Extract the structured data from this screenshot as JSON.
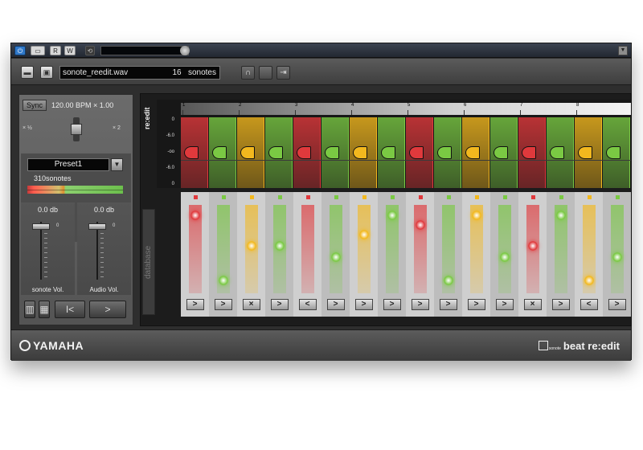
{
  "colors": {
    "red": "#e0393c",
    "green": "#7ac943",
    "yellow": "#f2b81e",
    "white": "#f4f4f4",
    "host_blue": "#2f78c9"
  },
  "host": {
    "power_icon": "power-icon",
    "buttons": [
      "R",
      "W"
    ]
  },
  "toolbar": {
    "filename": "sonote_reedit.wav",
    "count": "16",
    "count_unit": "sonotes"
  },
  "left": {
    "sync_label": "Sync",
    "bpm_text": "120.00  BPM × 1.00",
    "tempo_min": "× ½",
    "tempo_max": "× 2",
    "preset_name": "Preset1",
    "preset_count": "310sonotes",
    "fader1": {
      "db": "0.0 db",
      "zero": "0",
      "name": "sonote Vol."
    },
    "fader2": {
      "db": "0.0 db",
      "zero": "0",
      "name": "Audio Vol."
    },
    "nav_back": "I<",
    "nav_forward": ">"
  },
  "editor": {
    "tab_title": "re:edit",
    "tab_database": "database",
    "db_labels": [
      "0",
      "-6.0",
      "-oo",
      "-6.0",
      "0"
    ],
    "ruler": [
      "1",
      "2",
      "3",
      "4",
      "5",
      "6",
      "7",
      "8"
    ]
  },
  "columns": [
    {
      "color": "red",
      "dot_level": 0.05,
      "arrow": ">"
    },
    {
      "color": "green",
      "dot_level": 0.9,
      "arrow": ">"
    },
    {
      "color": "yellow",
      "dot_level": 0.45,
      "arrow": "×"
    },
    {
      "color": "green",
      "dot_level": 0.45,
      "arrow": ">"
    },
    {
      "color": "red",
      "dot_level": null,
      "arrow": "<"
    },
    {
      "color": "green",
      "dot_level": 0.6,
      "arrow": ">"
    },
    {
      "color": "yellow",
      "dot_level": 0.3,
      "arrow": ">"
    },
    {
      "color": "green",
      "dot_level": 0.05,
      "arrow": ">"
    },
    {
      "color": "red",
      "dot_level": 0.18,
      "arrow": ">"
    },
    {
      "color": "green",
      "dot_level": 0.9,
      "arrow": ">"
    },
    {
      "color": "yellow",
      "dot_level": 0.05,
      "arrow": ">"
    },
    {
      "color": "green",
      "dot_level": 0.6,
      "arrow": ">"
    },
    {
      "color": "red",
      "dot_level": 0.45,
      "arrow": "×"
    },
    {
      "color": "green",
      "dot_level": 0.05,
      "arrow": ">"
    },
    {
      "color": "yellow",
      "dot_level": 0.9,
      "arrow": "<"
    },
    {
      "color": "green",
      "dot_level": 0.6,
      "arrow": ">"
    }
  ],
  "footer": {
    "brand": "YAMAHA",
    "product_small": "sonote",
    "product": "beat re:edit"
  }
}
